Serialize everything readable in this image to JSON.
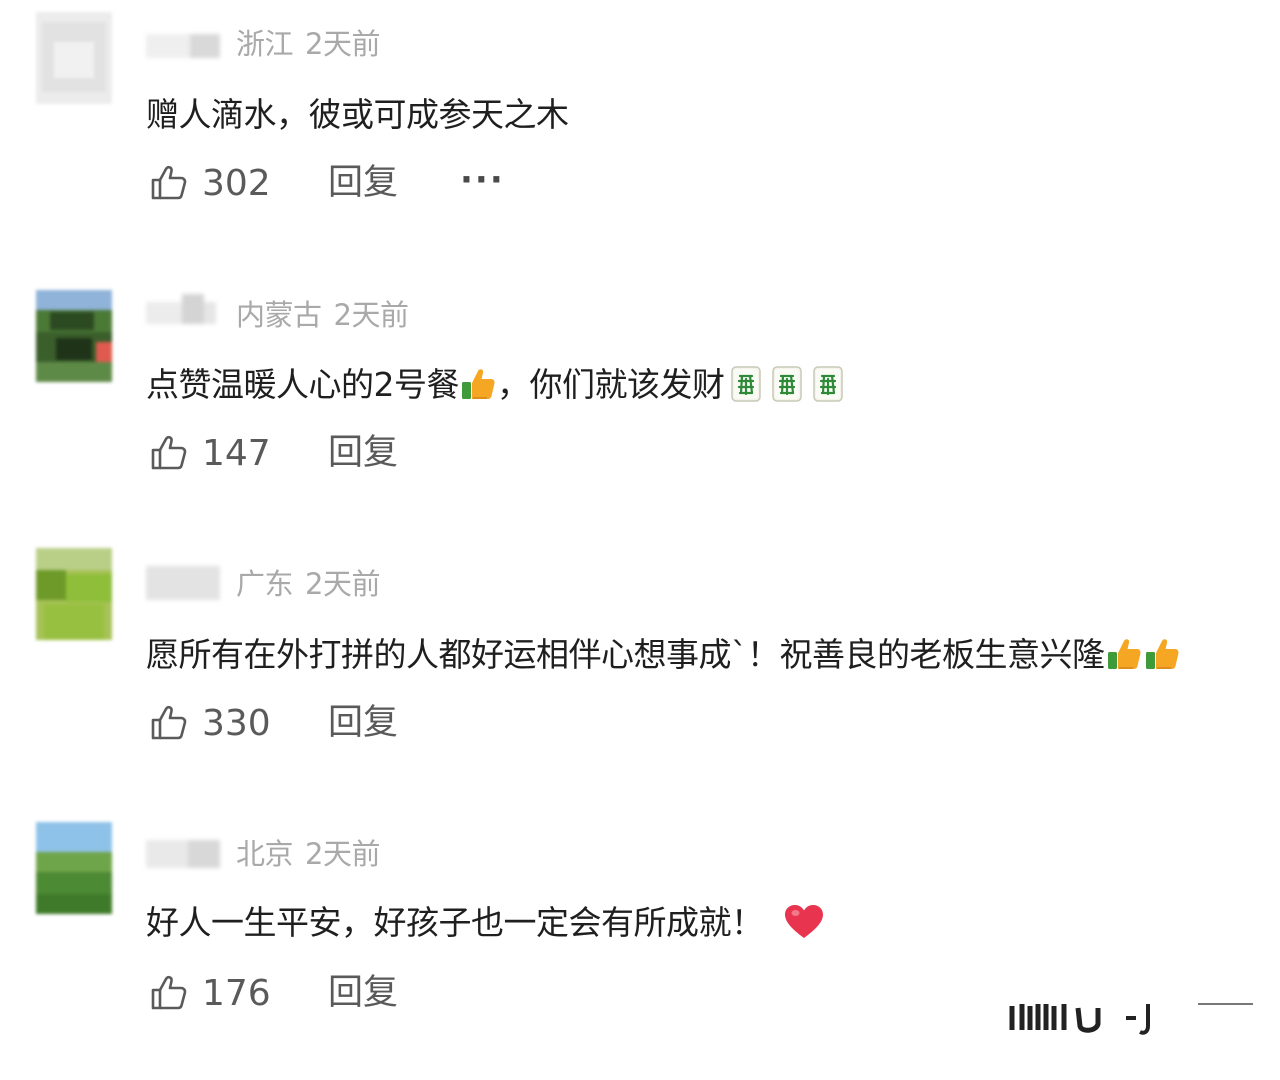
{
  "comments": [
    {
      "location": "浙江",
      "time": "2天前",
      "text": "赠人滴水，彼或可成参天之木",
      "likes": "302",
      "reply_label": "回复",
      "more_label": "···",
      "avatar_colors": [
        "#eeeeee",
        "#e4e4e4",
        "#f3f3f3"
      ]
    },
    {
      "location": "内蒙古",
      "time": "2天前",
      "text": "点赞温暖人心的2号餐",
      "text_2": "，你们就该发财",
      "likes": "147",
      "reply_label": "回复",
      "avatar_colors": [
        "#8fb3d9",
        "#3f6b2e",
        "#2c4a22",
        "#e05a4f"
      ]
    },
    {
      "location": "广东",
      "time": "2天前",
      "text": "愿所有在外打拼的人都好运相伴心想事成`！祝善良的老板生意兴隆",
      "likes": "330",
      "reply_label": "回复",
      "avatar_colors": [
        "#8fbf3a",
        "#6e9a2a",
        "#b9cf88",
        "#a7c257"
      ]
    },
    {
      "location": "北京",
      "time": "2天前",
      "text": "好人一生平安，好孩子也一定会有所成就！",
      "likes": "176",
      "reply_label": "回复",
      "avatar_colors": [
        "#8fc2e8",
        "#4d8a34",
        "#6fa54a",
        "#3f7a2a"
      ]
    }
  ],
  "icons": {
    "like": "thumbs-up-outline-icon",
    "thumbs_emoji": "thumbs-up-emoji-icon",
    "fa_tile": "mahjong-green-dragon-icon",
    "heart": "red-heart-icon"
  },
  "colors": {
    "text": "#1f1f1f",
    "meta": "#a9a9a9",
    "action": "#5a5a5a",
    "heart": "#e8344e",
    "thumb": "#f5a623"
  }
}
